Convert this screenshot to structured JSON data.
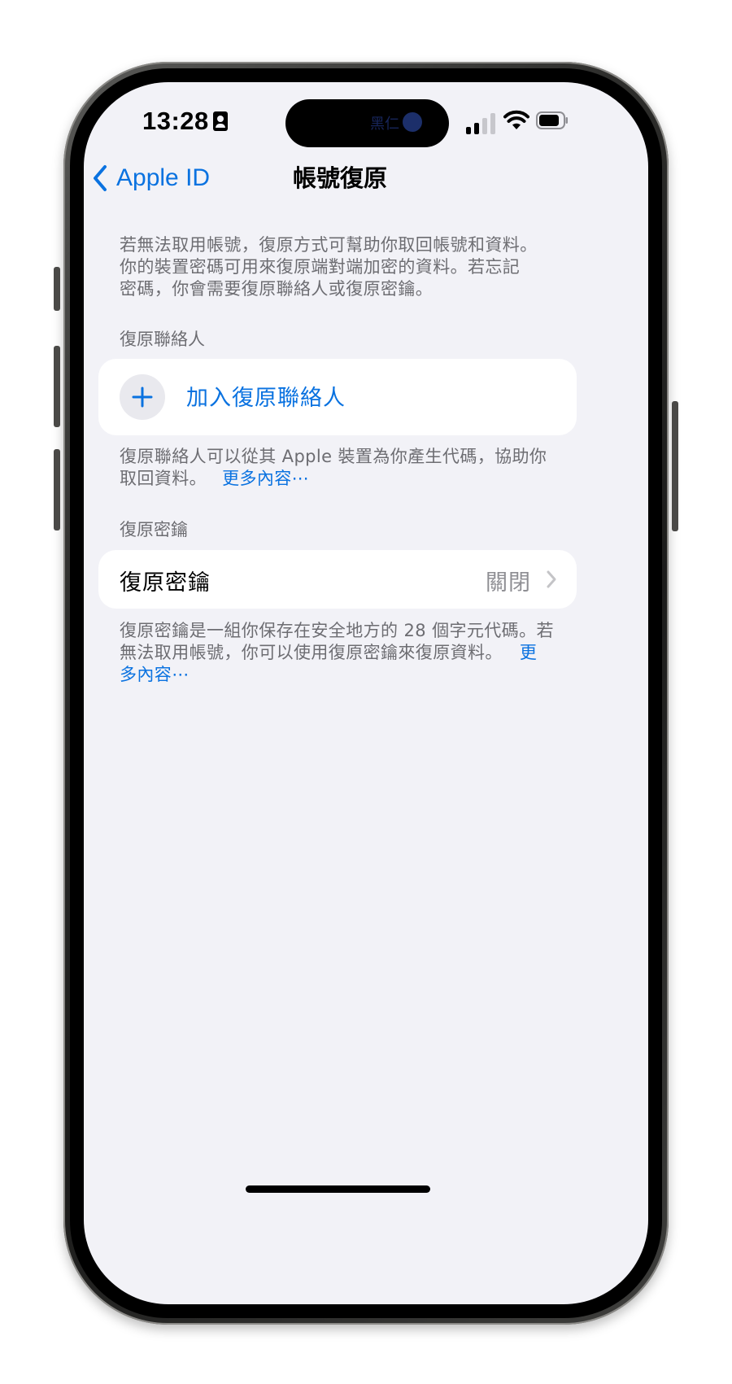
{
  "status_bar": {
    "time": "13:28",
    "island_text": "黑仁"
  },
  "nav": {
    "back_label": "Apple ID",
    "title": "帳號復原"
  },
  "intro": {
    "line1": "若無法取用帳號，復原方式可幫助你取回帳號和資料。",
    "line2": "你的裝置密碼可用來復原端對端加密的資料。若忘記",
    "line3": "密碼，你會需要復原聯絡人或復原密鑰。"
  },
  "recovery_contact": {
    "header": "復原聯絡人",
    "add_label": "加入復原聯絡人",
    "footer_line1": "復原聯絡人可以從其 Apple 裝置為你產生代碼，協助你",
    "footer_line2_text": "取回資料。",
    "footer_link": "更多內容⋯"
  },
  "recovery_key": {
    "header": "復原密鑰",
    "row_label": "復原密鑰",
    "row_value": "關閉",
    "footer_line1": "復原密鑰是一組你保存在安全地方的 28 個字元代碼。若",
    "footer_line2_text": "無法取用帳號，你可以使用復原密鑰來復原資料。",
    "footer_link_part1": "更",
    "footer_link_part2": "多內容⋯"
  },
  "colors": {
    "accent": "#0a72e0",
    "background": "#f2f2f7",
    "secondary_text": "#6d6d72",
    "card": "#ffffff"
  },
  "icons": {
    "back": "chevron-left-icon",
    "add": "plus-icon",
    "disclosure": "chevron-right-icon",
    "signal": "cellular-signal-icon",
    "wifi": "wifi-icon",
    "battery": "battery-icon",
    "contact": "contact-card-icon"
  }
}
